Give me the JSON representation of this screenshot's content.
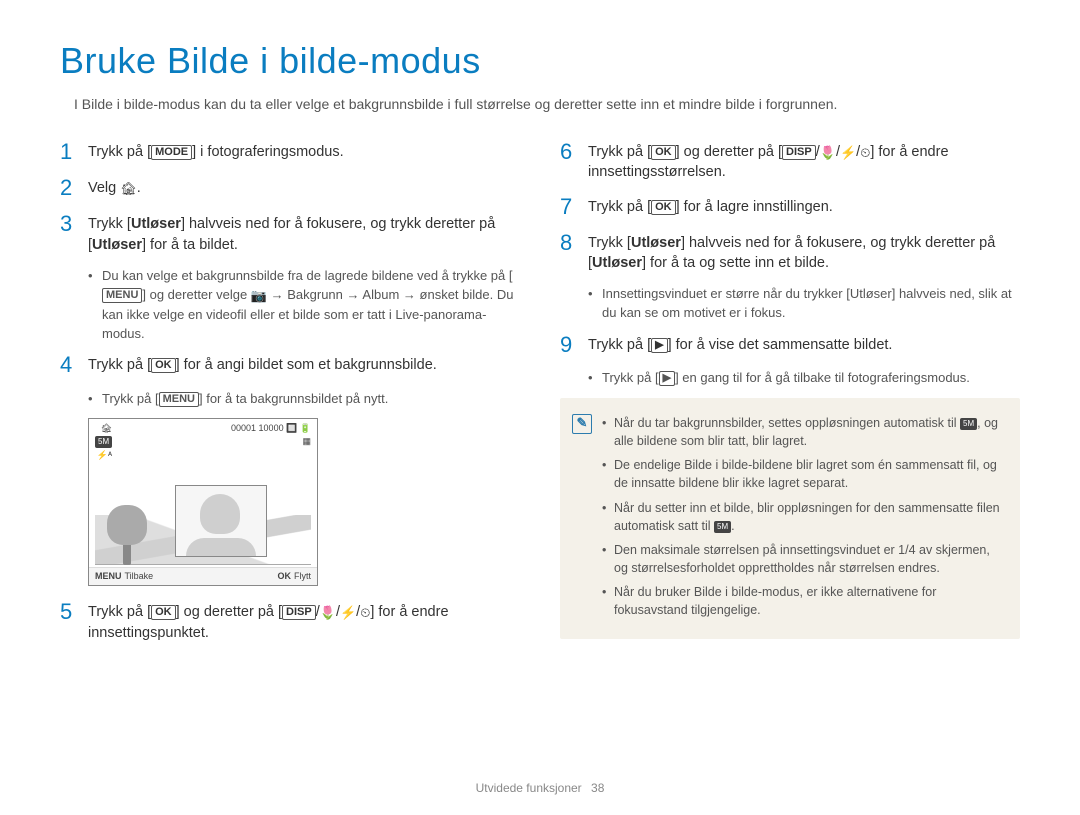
{
  "title": "Bruke Bilde i bilde-modus",
  "intro": "I Bilde i bilde-modus kan du ta eller velge et bakgrunnsbilde i full størrelse og deretter sette inn et mindre bilde i forgrunnen.",
  "icons": {
    "mode": "MODE",
    "menu": "MENU",
    "ok": "OK",
    "disp": "DISP",
    "camera": "📷",
    "macro": "🌷",
    "flash": "⚡",
    "timer": "⏲",
    "pip_mode": "🏚",
    "play": "▶",
    "arrow": "→",
    "size_5m": "5M"
  },
  "left_steps": {
    "s1": {
      "num": "1",
      "a": "Trykk på [",
      "b": "] i fotograferingsmodus."
    },
    "s2": {
      "num": "2",
      "a": "Velg ",
      "b": "."
    },
    "s3": {
      "num": "3",
      "a": "Trykk [",
      "shutter1": "Utløser",
      "b": "] halvveis ned for å fokusere, og trykk deretter på [",
      "shutter2": "Utløser",
      "c": "] for å ta bildet."
    },
    "s3_sub": {
      "line1a": "Du kan velge et bakgrunnsbilde fra de lagrede bildene ved å trykke på [",
      "line1b": "] og deretter velge ",
      "bg": "Bakgrunn",
      "album": "Album",
      "line1c": " ønsket bilde. Du kan ikke velge en videofil eller et bilde som er tatt i Live-panorama-modus."
    },
    "s4": {
      "num": "4",
      "a": "Trykk på [",
      "b": "] for å angi bildet som et bakgrunnsbilde."
    },
    "s4_sub": {
      "a": "Trykk på [",
      "b": "] for å ta bakgrunnsbildet på nytt."
    },
    "s5": {
      "num": "5",
      "a": "Trykk på [",
      "b": "] og deretter på [",
      "c": "] for å endre innsettingspunktet."
    }
  },
  "preview": {
    "counter": "00001",
    "remain": "10000",
    "res": "5M",
    "auto_flash": "⚡ᴬ",
    "back_key": "MENU",
    "back_label": "Tilbake",
    "move_key": "OK",
    "move_label": "Flytt"
  },
  "right_steps": {
    "s6": {
      "num": "6",
      "a": "Trykk på [",
      "b": "] og deretter på [",
      "c": "] for å endre innsettingsstørrelsen."
    },
    "s7": {
      "num": "7",
      "a": "Trykk på [",
      "b": "] for å lagre innstillingen."
    },
    "s8": {
      "num": "8",
      "a": "Trykk [",
      "shutter1": "Utløser",
      "b": "] halvveis ned for å fokusere, og trykk deretter på [",
      "shutter2": "Utløser",
      "c": "] for å ta og sette inn et bilde."
    },
    "s8_sub": {
      "a": "Innsettingsvinduet er større når du trykker [",
      "shutter": "Utløser",
      "b": "] halvveis ned, slik at du kan se om motivet er i fokus."
    },
    "s9": {
      "num": "9",
      "a": "Trykk på [",
      "b": "] for å vise det sammensatte bildet."
    },
    "s9_sub": {
      "a": "Trykk på [",
      "b": "] en gang til for å gå tilbake til fotograferingsmodus."
    }
  },
  "notes": [
    {
      "a": "Når du tar bakgrunnsbilder, settes oppløsningen automatisk til ",
      "b": ", og alle bildene som blir tatt, blir lagret."
    },
    {
      "a": "De endelige Bilde i bilde-bildene blir lagret som én sammensatt fil, og de innsatte bildene blir ikke lagret separat."
    },
    {
      "a": "Når du setter inn et bilde, blir oppløsningen for den sammensatte filen automatisk satt til ",
      "b": "."
    },
    {
      "a": "Den maksimale størrelsen på innsettingsvinduet er 1/4 av skjermen, og størrelsesforholdet opprettholdes når størrelsen endres."
    },
    {
      "a": "Når du bruker Bilde i bilde-modus, er ikke alternativene for fokusavstand tilgjengelige."
    }
  ],
  "footer": {
    "section": "Utvidede funksjoner",
    "page": "38"
  }
}
